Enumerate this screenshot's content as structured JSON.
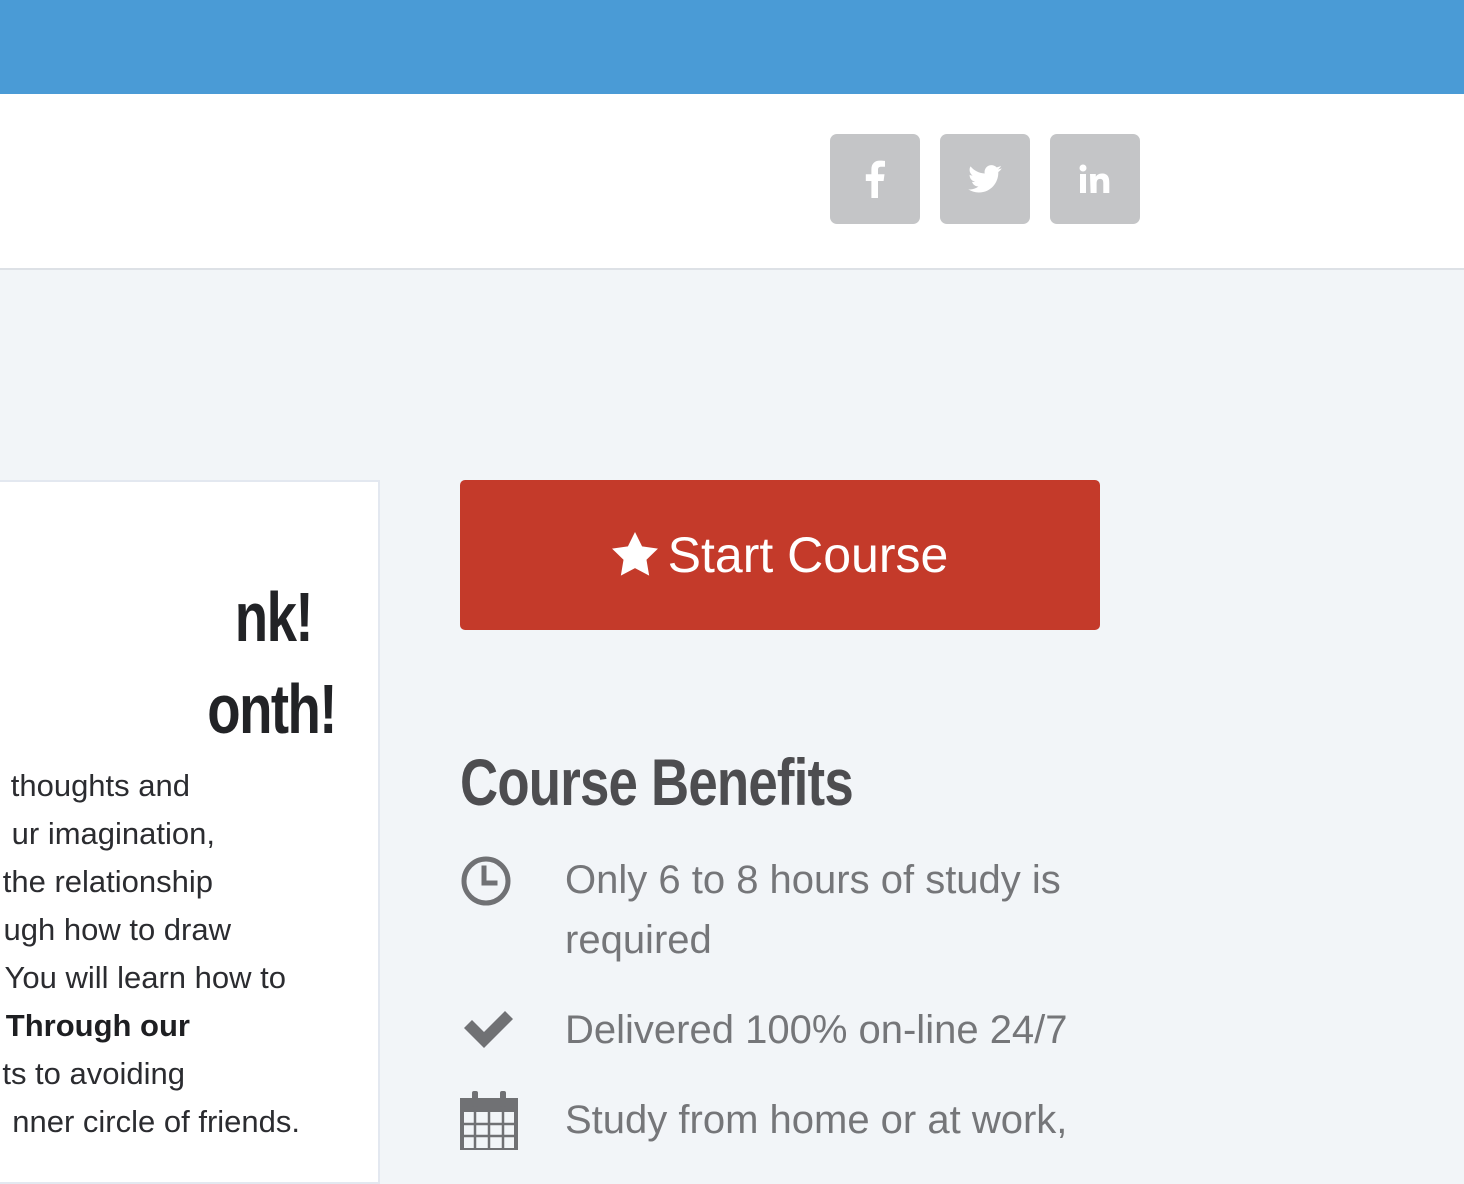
{
  "header": {
    "social": [
      {
        "name": "facebook",
        "icon": "facebook-icon"
      },
      {
        "name": "twitter",
        "icon": "twitter-icon"
      },
      {
        "name": "linkedin",
        "icon": "linkedin-icon"
      }
    ]
  },
  "card": {
    "title_lines": [
      "nk!",
      "onth!"
    ],
    "body_lines": [
      {
        "text": "thoughts and"
      },
      {
        "text": "ur imagination,"
      },
      {
        "text": "the relationship"
      },
      {
        "text": "ugh how to draw"
      },
      {
        "text": "You will learn how to"
      },
      {
        "prefix": ". ",
        "bold": "Through our"
      },
      {
        "text": "ts to avoiding"
      },
      {
        "text": "nner circle of friends."
      }
    ]
  },
  "cta": {
    "label": "Start Course",
    "icon": "star-icon",
    "color": "#c43a2a"
  },
  "benefits": {
    "title": "Course Benefits",
    "items": [
      {
        "icon": "clock-icon",
        "text": "Only 6 to 8 hours of study is required"
      },
      {
        "icon": "check-icon",
        "text": "Delivered 100% on-line 24/7"
      },
      {
        "icon": "calendar-icon",
        "text": "Study from home or at work,"
      }
    ]
  },
  "colors": {
    "topbar": "#4a9bd6",
    "page_bg": "#f2f5f8",
    "social_bg": "#c4c5c7"
  }
}
